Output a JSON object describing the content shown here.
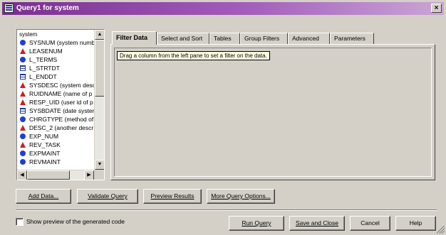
{
  "window": {
    "title": "Query1 for system",
    "close_glyph": "×"
  },
  "field_list": {
    "root_label": "system",
    "items": [
      {
        "label": "SYSNUM (system numb",
        "icon": "numeric-icon"
      },
      {
        "label": "LEASENUM",
        "icon": "character-icon"
      },
      {
        "label": "L_TERMS",
        "icon": "numeric-icon"
      },
      {
        "label": "L_STRTDT",
        "icon": "date-icon"
      },
      {
        "label": "L_ENDDT",
        "icon": "date-icon"
      },
      {
        "label": "SYSDESC (system desc",
        "icon": "character-icon"
      },
      {
        "label": "RUIDNAME (name of p",
        "icon": "character-icon"
      },
      {
        "label": "RESP_UID (user id of p",
        "icon": "character-icon"
      },
      {
        "label": "SYSBDATE (date syster",
        "icon": "date-icon"
      },
      {
        "label": "CHRGTYPE (method of",
        "icon": "numeric-icon"
      },
      {
        "label": "DESC_2 (another descr",
        "icon": "character-icon"
      },
      {
        "label": "EXP_NUM",
        "icon": "numeric-icon"
      },
      {
        "label": "REV_TASK",
        "icon": "character-icon"
      },
      {
        "label": "EXPMAINT",
        "icon": "numeric-icon"
      },
      {
        "label": "REVMAINT",
        "icon": "numeric-icon"
      }
    ]
  },
  "tabs": [
    {
      "label": "Filter Data",
      "active": true
    },
    {
      "label": "Select and Sort"
    },
    {
      "label": "Tables"
    },
    {
      "label": "Group Filters"
    },
    {
      "label": "Advanced"
    },
    {
      "label": "Parameters"
    }
  ],
  "filter_panel": {
    "hint": "Drag a column from the left pane to set a filter on the data."
  },
  "actions": {
    "add_data": "Add Data...",
    "validate_query": "Validate Query",
    "preview_results": "Preview Results",
    "more_query_options": "More Query Options..."
  },
  "footer": {
    "show_preview_label": "Show preview of the generated code",
    "show_preview_checked": false,
    "run_query": "Run Query",
    "save_and_close": "Save and Close",
    "cancel": "Cancel",
    "help": "Help"
  }
}
